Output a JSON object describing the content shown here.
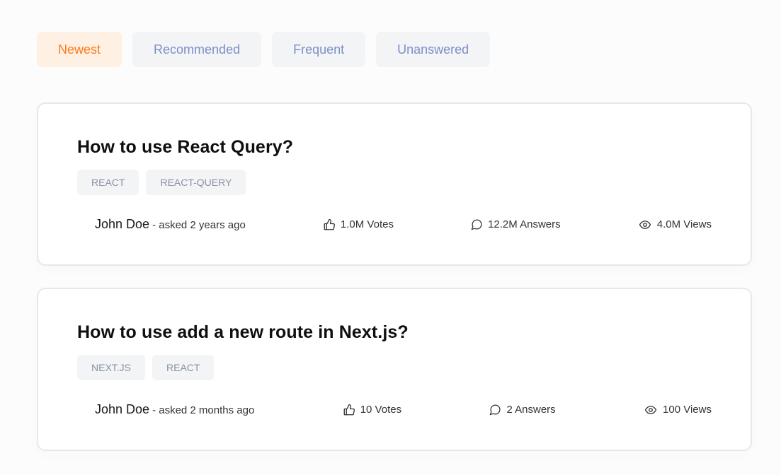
{
  "filters": [
    {
      "label": "Newest",
      "active": true
    },
    {
      "label": "Recommended",
      "active": false
    },
    {
      "label": "Frequent",
      "active": false
    },
    {
      "label": "Unanswered",
      "active": false
    }
  ],
  "questions": [
    {
      "title": "How to use React Query?",
      "tags": [
        "REACT",
        "REACT-QUERY"
      ],
      "author": "John Doe",
      "asked": "- asked 2 years ago",
      "votes": "1.0M Votes",
      "answers": "12.2M Answers",
      "views": "4.0M Views"
    },
    {
      "title": "How to use add a new route in Next.js?",
      "tags": [
        "NEXT.JS",
        "REACT"
      ],
      "author": "John Doe",
      "asked": "- asked 2 months ago",
      "votes": "10 Votes",
      "answers": "2 Answers",
      "views": "100 Views"
    }
  ],
  "colors": {
    "accent": "#ff7a1a",
    "accent_bg": "#fff0e4",
    "filter_text": "#7b8ec8",
    "tag_text": "#8a91a8"
  },
  "icons": {
    "votes": "thumbs-up-icon",
    "answers": "message-circle-icon",
    "views": "eye-icon"
  }
}
